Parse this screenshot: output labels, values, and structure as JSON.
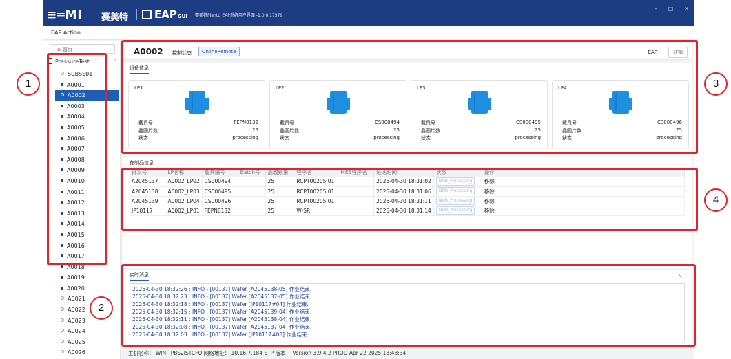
{
  "titlebar": {
    "logo_semi": "≡═MI",
    "logo_cn": "赛美特",
    "logo_eap": "EAP",
    "logo_gui": "GUI",
    "subtitle": "赛美特PlantU EAP系统用户界面 -1.0.0.17579",
    "min": "–",
    "max": "□",
    "close": "✕"
  },
  "menu": {
    "label": "EAP Action"
  },
  "sidebar": {
    "home_label": "首页",
    "root_label": "PressureTest",
    "items": [
      {
        "label": "SCBSS01",
        "state": "empty"
      },
      {
        "label": "A0001",
        "state": "filled"
      },
      {
        "label": "A0002",
        "state": "selected"
      },
      {
        "label": "A0003",
        "state": "filled"
      },
      {
        "label": "A0004",
        "state": "filled"
      },
      {
        "label": "A0005",
        "state": "filled"
      },
      {
        "label": "A0006",
        "state": "filled"
      },
      {
        "label": "A0007",
        "state": "filled"
      },
      {
        "label": "A0008",
        "state": "filled"
      },
      {
        "label": "A0009",
        "state": "filled"
      },
      {
        "label": "A0010",
        "state": "filled"
      },
      {
        "label": "A0011",
        "state": "filled"
      },
      {
        "label": "A0012",
        "state": "filled"
      },
      {
        "label": "A0013",
        "state": "filled"
      },
      {
        "label": "A0014",
        "state": "filled"
      },
      {
        "label": "A0015",
        "state": "filled"
      },
      {
        "label": "A0016",
        "state": "filled"
      },
      {
        "label": "A0017",
        "state": "filled"
      },
      {
        "label": "A0018",
        "state": "filled"
      },
      {
        "label": "A0019",
        "state": "filled"
      },
      {
        "label": "A0020",
        "state": "filled"
      },
      {
        "label": "A0021",
        "state": "empty"
      },
      {
        "label": "A0022",
        "state": "empty"
      },
      {
        "label": "A0023",
        "state": "empty"
      },
      {
        "label": "A0024",
        "state": "empty"
      },
      {
        "label": "A0025",
        "state": "empty"
      },
      {
        "label": "A0026",
        "state": "empty"
      }
    ]
  },
  "header": {
    "equipment": "A0002",
    "control_label": "控制状态",
    "control_value": "OnlineRemote",
    "eap_label": "EAP",
    "logout_label": "注销"
  },
  "device_info": {
    "title": "设备信息",
    "carrier_label": "载具号",
    "wafer_count_label": "晶圆片数",
    "status_label": "状态",
    "ports": [
      {
        "name": "LP1",
        "carrier": "FEPN0132",
        "wafers": "25",
        "status": "processing"
      },
      {
        "name": "LP2",
        "carrier": "CS000494",
        "wafers": "25",
        "status": "processing"
      },
      {
        "name": "LP3",
        "carrier": "CS000495",
        "wafers": "25",
        "status": "processing"
      },
      {
        "name": "LP4",
        "carrier": "CS000496",
        "wafers": "25",
        "status": "processing"
      }
    ]
  },
  "wip": {
    "title": "在制品信息",
    "columns": [
      "批次号",
      "LP名称",
      "载具编号",
      "Batch号",
      "晶圆数量",
      "程序名",
      "MES程序名",
      "进站时间",
      "状态",
      "操作"
    ],
    "rows": [
      [
        "A2045137",
        "A0002_LP02",
        "CS000494",
        "",
        "25",
        "RCPT00205.01",
        "",
        "2025-04-30 18:31:02",
        "NOR_Processing",
        "移除"
      ],
      [
        "A2045138",
        "A0002_LP03",
        "CS000495",
        "",
        "25",
        "RCPT00205.01",
        "",
        "2025-04-30 18:31:06",
        "NOR_Processing",
        "移除"
      ],
      [
        "A2045139",
        "A0002_LP04",
        "CS000496",
        "",
        "25",
        "RCPT00205.01",
        "",
        "2025-04-30 18:31:11",
        "NOR_Processing",
        "移除"
      ],
      [
        "JP10117",
        "A0002_LP01",
        "FEPN0132",
        "",
        "25",
        "W-SR",
        "",
        "2025-04-30 18:31:14",
        "NOR_Processing",
        "移除"
      ]
    ]
  },
  "messages": {
    "title": "实时消息",
    "filter_icon": "⊤ ∨",
    "lines": [
      "2025-04-30 18:32:26 : INFO - [00137]  Wafer [A2045138-05] 作业结束.",
      "2025-04-30 18:32:23 : INFO - [00137]  Wafer [A2045137-05] 作业结束.",
      "2025-04-30 18:32:18 : INFO - [00137]  Wafer [JP10117#04] 作业结束.",
      "2025-04-30 18:32:15 : INFO - [00137]  Wafer [A2045139-04] 作业结束.",
      "2025-04-30 18:32:11 : INFO - [00137]  Wafer [A2045138-04] 作业结束.",
      "2025-04-30 18:32:08 : INFO - [00137]  Wafer [A2045137-04] 作业结束.",
      "2025-04-30 18:32:03 : INFO - [00137]  Wafer [JP10117#03] 作业结束."
    ]
  },
  "status_bar": {
    "text": "主机名称： WIN-TPBS2ISTCFO     网络地址： 10.16.7.184     STP 版本： Version 3.9.4.2 PROD  Apr 22 2025 13:48:34"
  },
  "annotations": [
    "1",
    "2",
    "3",
    "4"
  ],
  "colors": {
    "titlebar": "#1d3d82",
    "selected": "#1e5fb5",
    "annotation": "#e0242c",
    "carrier_icon": "#1e8fe0"
  }
}
